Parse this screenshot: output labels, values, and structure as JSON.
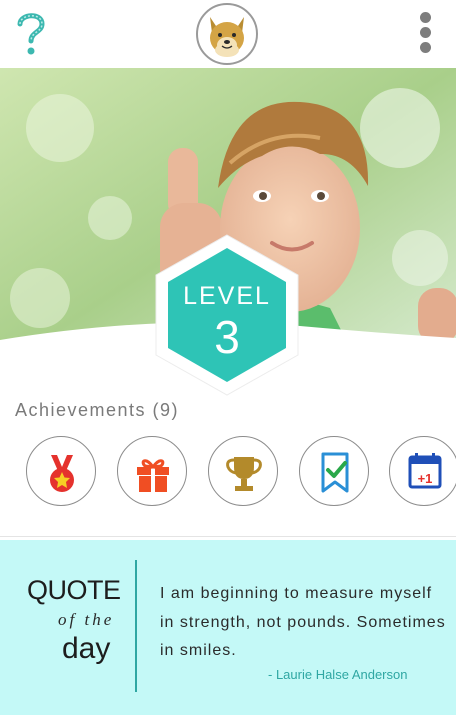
{
  "header": {
    "help_icon": "question-mark-icon",
    "avatar_icon": "dog-avatar-icon",
    "menu_icon": "vertical-dots-icon"
  },
  "hero": {
    "image": "boy-thumbs-up-photo",
    "level_label": "LEVEL",
    "level_number": "3",
    "badge_color": "#2ec4b6"
  },
  "achievements": {
    "title": "Achievements (9)",
    "items": [
      {
        "icon": "medal-star-icon",
        "color": "#e5322d"
      },
      {
        "icon": "gift-icon",
        "color": "#f04e23"
      },
      {
        "icon": "trophy-icon",
        "color": "#b38a2b"
      },
      {
        "icon": "bookmark-check-icon",
        "color": "#2a8fd6"
      },
      {
        "icon": "calendar-plus-one-icon",
        "color": "#1f4fb8"
      }
    ]
  },
  "quote": {
    "heading_quote": "QUOTE",
    "heading_ofthe": "of the",
    "heading_day": "day",
    "text": "I am beginning to measure myself in strength, not pounds. Sometimes in smiles.",
    "author": "- Laurie Halse Anderson",
    "background": "#c4f9f7",
    "accent": "#2fa7a3"
  }
}
